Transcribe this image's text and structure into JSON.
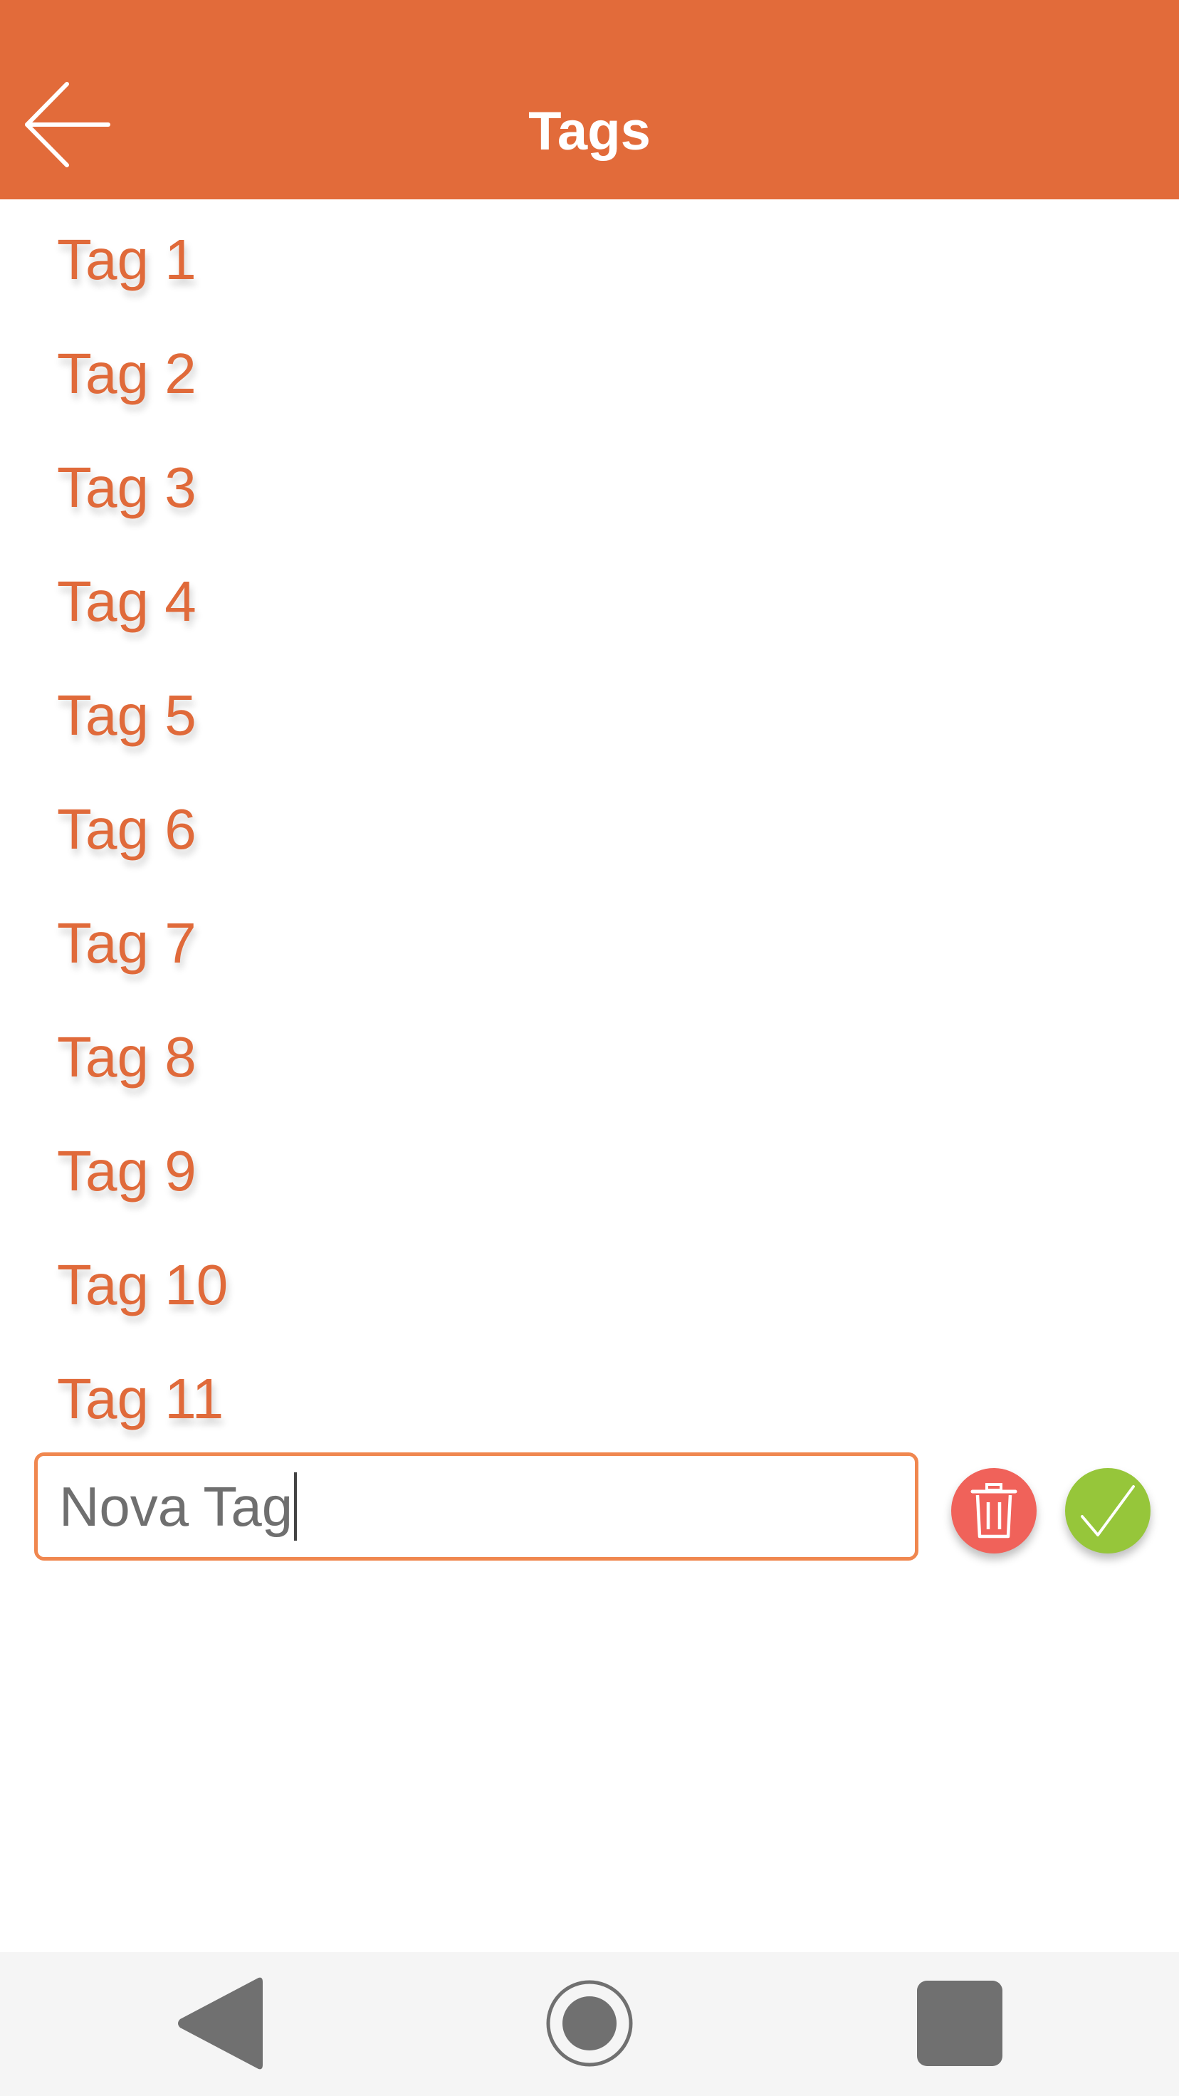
{
  "header": {
    "title": "Tags",
    "back_icon": "arrow-left-icon",
    "background_color": "#E26B3A"
  },
  "tags": [
    {
      "label": "Tag 1"
    },
    {
      "label": "Tag 2"
    },
    {
      "label": "Tag 3"
    },
    {
      "label": "Tag 4"
    },
    {
      "label": "Tag 5"
    },
    {
      "label": "Tag 6"
    },
    {
      "label": "Tag 7"
    },
    {
      "label": "Tag 8"
    },
    {
      "label": "Tag 9"
    },
    {
      "label": "Tag 10"
    },
    {
      "label": "Tag 11"
    }
  ],
  "editor": {
    "value": "Nova Tag",
    "delete_icon": "trash-icon",
    "confirm_icon": "check-icon",
    "delete_color": "#F0625A",
    "confirm_color": "#96C63A",
    "border_color": "#F0874F"
  },
  "nav": {
    "back_icon": "triangle-back-icon",
    "home_icon": "circle-home-icon",
    "recents_icon": "square-recents-icon"
  },
  "colors": {
    "accent": "#E06A3A"
  }
}
